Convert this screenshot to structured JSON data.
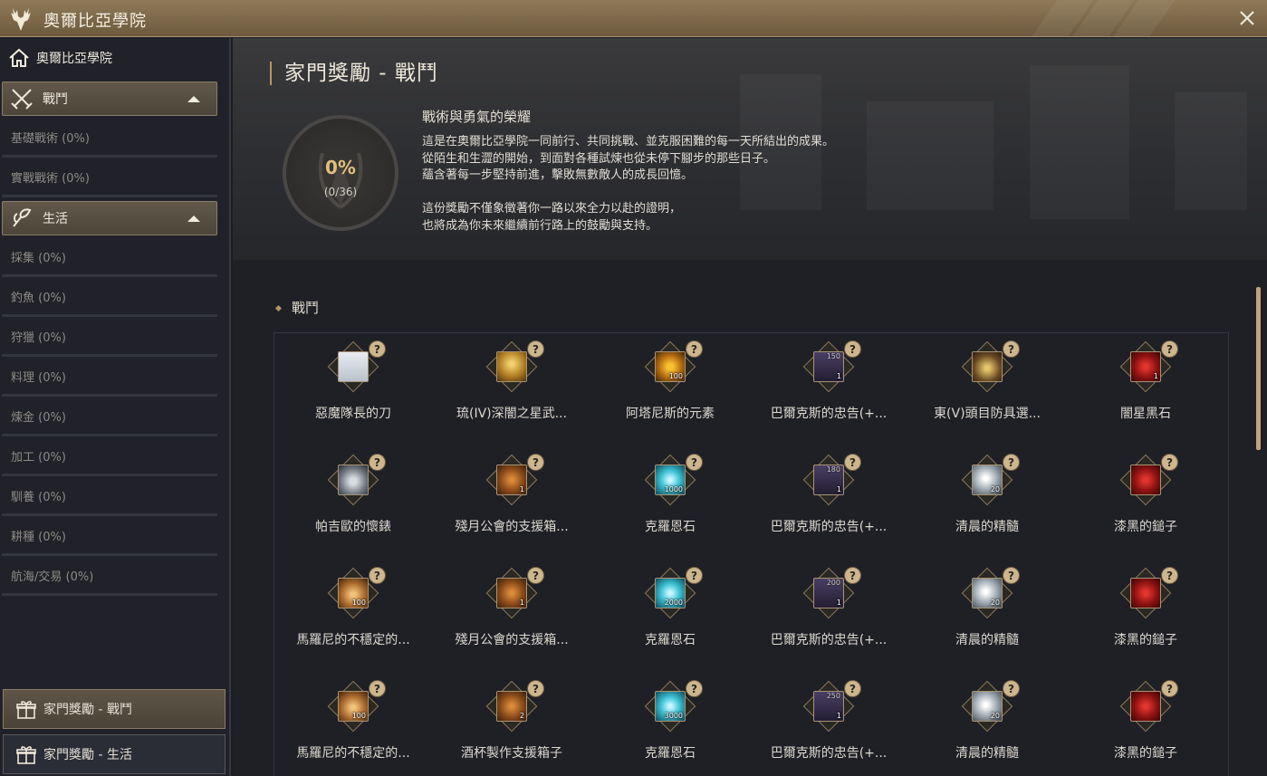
{
  "window": {
    "title": "奧爾比亞學院"
  },
  "sidebar": {
    "home": "奧爾比亞學院",
    "categories": [
      {
        "label": "戰鬥",
        "icon": "crossed-swords-icon",
        "items": [
          "基礎戰術 (0%)",
          "實戰戰術 (0%)"
        ]
      },
      {
        "label": "生活",
        "icon": "life-skill-icon",
        "items": [
          "採集 (0%)",
          "釣魚 (0%)",
          "狩獵 (0%)",
          "料理 (0%)",
          "煉金 (0%)",
          "加工 (0%)",
          "馴養 (0%)",
          "耕種 (0%)",
          "航海/交易 (0%)"
        ]
      }
    ],
    "reward_buttons": [
      {
        "label": "家門獎勵 - 戰鬥",
        "active": true
      },
      {
        "label": "家門獎勵 - 生活",
        "active": false
      }
    ]
  },
  "main": {
    "title": "家門獎勵 - 戰鬥",
    "progress": {
      "percent": "0%",
      "count": "(0/36)",
      "value": 0
    },
    "description_title": "戰術與勇氣的榮耀",
    "description_lines": [
      "這是在奧爾比亞學院一同前行、共同挑戰、並克服困難的每一天所結出的成果。",
      "從陌生和生澀的開始，到面對各種試煉也從未停下腳步的那些日子。",
      "蘊含著每一步堅持前進，擊敗無數敵人的成長回憶。",
      "",
      "這份獎勵不僅象徵著你一路以來全力以赴的證明，",
      "也將成為你未來繼續前行路上的鼓勵與支持。"
    ],
    "section_label": "戰鬥",
    "help_symbol": "?",
    "rewards": [
      [
        {
          "name": "惡魔隊長的刀",
          "icon": "sword-icon",
          "tile": "t-blade",
          "qty": "",
          "top": ""
        },
        {
          "name": "琉(IV)深闇之星武...",
          "icon": "weapon-chest-icon",
          "tile": "t-gold",
          "qty": "",
          "top": ""
        },
        {
          "name": "阿塔尼斯的元素",
          "icon": "element-orb-icon",
          "tile": "t-amber",
          "qty": "100",
          "top": ""
        },
        {
          "name": "巴爾克斯的忠告(+...",
          "icon": "advice-banner-icon",
          "tile": "t-banner",
          "qty": "1",
          "top": "150"
        },
        {
          "name": "東(V)頭目防具選...",
          "icon": "armor-chest-icon",
          "tile": "t-chest",
          "qty": "",
          "top": ""
        },
        {
          "name": "闇星黑石",
          "icon": "black-stone-icon",
          "tile": "t-red",
          "qty": "1",
          "top": ""
        }
      ],
      [
        {
          "name": "帕吉歐的懷錶",
          "icon": "pocket-watch-icon",
          "tile": "t-watch",
          "qty": "",
          "top": ""
        },
        {
          "name": "殘月公會的支援箱...",
          "icon": "support-box-icon",
          "tile": "t-brown",
          "qty": "1",
          "top": ""
        },
        {
          "name": "克羅恩石",
          "icon": "cron-stone-icon",
          "tile": "t-cyan",
          "qty": "1000",
          "top": ""
        },
        {
          "name": "巴爾克斯的忠告(+...",
          "icon": "advice-banner-icon",
          "tile": "t-banner",
          "qty": "1",
          "top": "180"
        },
        {
          "name": "清晨的精髓",
          "icon": "essence-icon",
          "tile": "t-silver",
          "qty": "20",
          "top": ""
        },
        {
          "name": "漆黑的鎚子",
          "icon": "black-hammer-icon",
          "tile": "t-red",
          "qty": "",
          "top": ""
        }
      ],
      [
        {
          "name": "馬羅尼的不穩定的...",
          "icon": "pouch-icon",
          "tile": "t-pouch",
          "qty": "100",
          "top": ""
        },
        {
          "name": "殘月公會的支援箱...",
          "icon": "support-box-icon",
          "tile": "t-brown",
          "qty": "1",
          "top": ""
        },
        {
          "name": "克羅恩石",
          "icon": "cron-stone-icon",
          "tile": "t-cyan",
          "qty": "2000",
          "top": ""
        },
        {
          "name": "巴爾克斯的忠告(+...",
          "icon": "advice-banner-icon",
          "tile": "t-banner",
          "qty": "1",
          "top": "200"
        },
        {
          "name": "清晨的精髓",
          "icon": "essence-icon",
          "tile": "t-silver",
          "qty": "20",
          "top": ""
        },
        {
          "name": "漆黑的鎚子",
          "icon": "black-hammer-icon",
          "tile": "t-red",
          "qty": "",
          "top": ""
        }
      ],
      [
        {
          "name": "馬羅尼的不穩定的...",
          "icon": "pouch-icon",
          "tile": "t-pouch",
          "qty": "100",
          "top": ""
        },
        {
          "name": "酒杯製作支援箱子",
          "icon": "support-box-icon",
          "tile": "t-brown",
          "qty": "2",
          "top": ""
        },
        {
          "name": "克羅恩石",
          "icon": "cron-stone-icon",
          "tile": "t-cyan",
          "qty": "3000",
          "top": ""
        },
        {
          "name": "巴爾克斯的忠告(+...",
          "icon": "advice-banner-icon",
          "tile": "t-banner",
          "qty": "1",
          "top": "250"
        },
        {
          "name": "清晨的精髓",
          "icon": "essence-icon",
          "tile": "t-silver",
          "qty": "20",
          "top": ""
        },
        {
          "name": "漆黑的鎚子",
          "icon": "black-hammer-icon",
          "tile": "t-red",
          "qty": "",
          "top": ""
        }
      ]
    ]
  },
  "colors": {
    "accent": "#b89563",
    "titlebar": "#7d6a4c",
    "progress_text": "#e0c079"
  }
}
